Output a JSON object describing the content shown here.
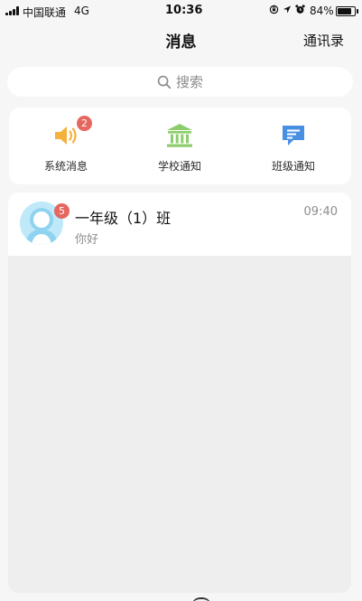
{
  "status_bar": {
    "carrier": "中国联通",
    "network": "4G",
    "time": "10:36",
    "battery_percent": "84%",
    "battery_level": 0.84,
    "icons": [
      "signal-bars-icon",
      "orientation-lock-icon",
      "location-arrow-icon",
      "alarm-clock-icon",
      "battery-icon"
    ]
  },
  "nav": {
    "title": "消息",
    "contacts_label": "通讯录"
  },
  "search": {
    "placeholder": "搜索",
    "icon": "search-icon"
  },
  "quick_entries": [
    {
      "label": "系统消息",
      "icon": "speaker-icon",
      "badge": "2",
      "color": "#f5b13d"
    },
    {
      "label": "学校通知",
      "icon": "school-building-icon",
      "color": "#8ccc6b"
    },
    {
      "label": "班级通知",
      "icon": "chat-bubble-icon",
      "color": "#4a90e2"
    }
  ],
  "conversations": [
    {
      "name": "一年级（1）班",
      "preview": "你好",
      "time": "09:40",
      "unread": "5",
      "avatar": "default-avatar-icon",
      "avatar_color": "#bfe9f9"
    }
  ],
  "colors": {
    "badge": "#e6675f",
    "background": "#f6f6f6",
    "card": "#ffffff",
    "content_background": "#eeeeee"
  }
}
